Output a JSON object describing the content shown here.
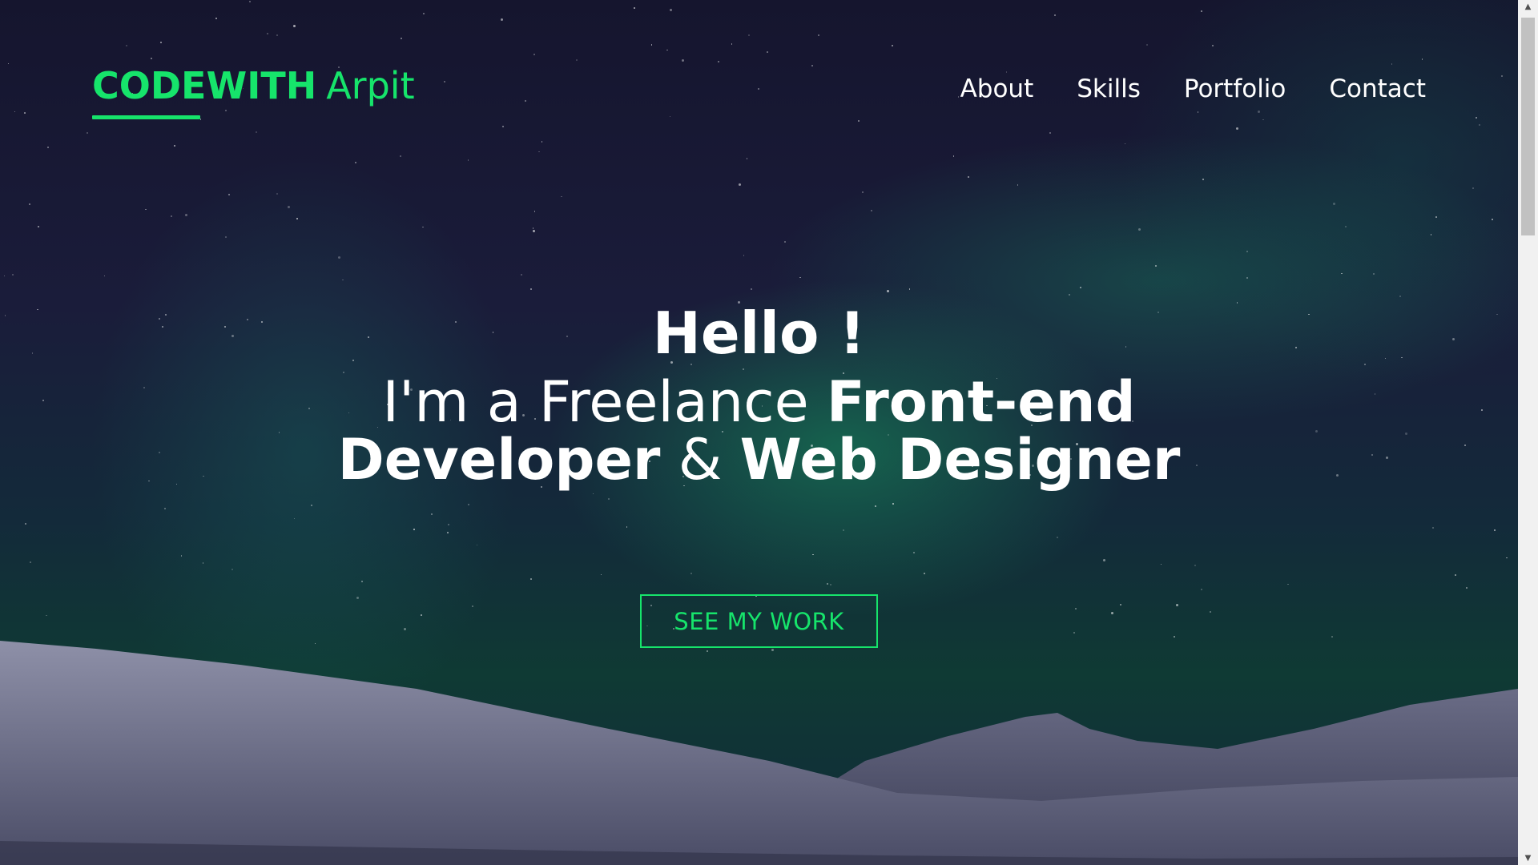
{
  "header": {
    "logo_bold": "CODEWITH",
    "logo_light": "Arpit",
    "nav": [
      {
        "label": "About"
      },
      {
        "label": "Skills"
      },
      {
        "label": "Portfolio"
      },
      {
        "label": "Contact"
      }
    ]
  },
  "hero": {
    "greeting": "Hello !",
    "line1_light": "I'm a Freelance ",
    "line1_bold": "Front-end",
    "line2_bold1": "Developer",
    "line2_light": " & ",
    "line2_bold2": "Web Designer",
    "cta_label": "SEE MY WORK"
  },
  "colors": {
    "accent": "#16e46b",
    "text": "#ffffff",
    "background": "#14162c"
  },
  "icons": {
    "scroll_up": "scroll-up-arrow-icon",
    "scroll_down": "scroll-down-arrow-icon"
  }
}
